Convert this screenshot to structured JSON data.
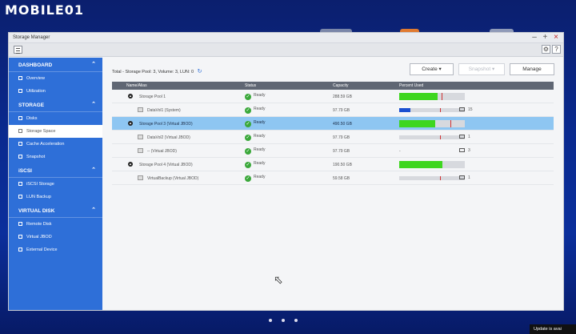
{
  "watermark": "MOBILE01",
  "window": {
    "title": "Storage Manager",
    "controls": [
      "–",
      "+",
      "×"
    ]
  },
  "toolbar": {
    "gear": "⚙",
    "help": "?"
  },
  "sidebar": {
    "sections": [
      {
        "label": "DASHBOARD",
        "items": [
          "Overview",
          "Utilization"
        ]
      },
      {
        "label": "STORAGE",
        "items": [
          "Disks",
          "Storage Space",
          "Cache Acceleration",
          "Snapshot"
        ]
      },
      {
        "label": "iSCSI",
        "items": [
          "iSCSI Storage",
          "LUN Backup"
        ]
      },
      {
        "label": "VIRTUAL DISK",
        "items": [
          "Remote Disk",
          "Virtual JBOD",
          "External Device"
        ]
      }
    ],
    "active_item": "Storage Space"
  },
  "main": {
    "summary": "Total - Storage Pool: 3, Volume: 3, LUN: 0",
    "buttons": {
      "create": "Create ▾",
      "snapshot": "Snapshot ▾",
      "manage": "Manage"
    },
    "columns": [
      "Name/Alias",
      "Status",
      "Capacity",
      "Percent Used"
    ],
    "rows": [
      {
        "name": "Storage Pool 1",
        "status": "Ready",
        "capacity": "288.59 GB",
        "snap": ""
      },
      {
        "name": "DataVol1 (System)",
        "status": "Ready",
        "capacity": "97.79 GB",
        "snap": "15"
      },
      {
        "name": "Storage Pool 3 (Virtual JBOD)",
        "status": "Ready",
        "capacity": "490.50 GB",
        "snap": ""
      },
      {
        "name": "DataVol2 (Virtual JBOD)",
        "status": "Ready",
        "capacity": "97.79 GB",
        "snap": "1"
      },
      {
        "name": "-- (Virtual JBOD)",
        "status": "Ready",
        "capacity": "97.79 GB",
        "snap": "3",
        "dash": "-"
      },
      {
        "name": "Storage Pool 4 (Virtual JBOD)",
        "status": "Ready",
        "capacity": "190.50 GB",
        "snap": ""
      },
      {
        "name": "VirtualBackup (Virtual JBOD)",
        "status": "Ready",
        "capacity": "59.58 GB",
        "snap": "1"
      }
    ],
    "usage": [
      {
        "used": 0.58,
        "threshold": 0.65,
        "color": "#3ed61f"
      },
      {
        "used": 0.17,
        "threshold": 0.62,
        "color": "#1a4fd0"
      },
      {
        "used": 0.55,
        "threshold": 0.78,
        "color": "#3ed61f"
      },
      {
        "used": 0.0,
        "threshold": 0.62,
        "color": "#1a4fd0"
      },
      null,
      {
        "used": 0.66,
        "threshold": null,
        "color": "#3ed61f"
      },
      {
        "used": 0.0,
        "threshold": 0.62,
        "color": "#1a4fd0"
      }
    ]
  },
  "notification": "Update is avai"
}
